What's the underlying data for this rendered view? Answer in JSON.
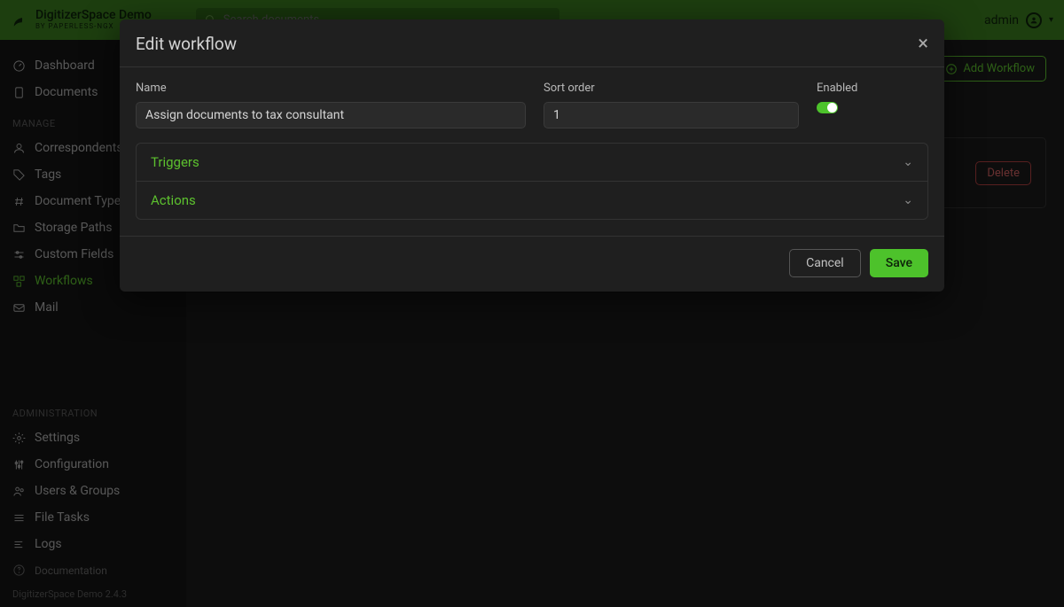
{
  "brand": {
    "title": "DigitizerSpace Demo",
    "subtitle": "BY PAPERLESS-NGX"
  },
  "search": {
    "placeholder": "Search documents"
  },
  "user": {
    "name": "admin"
  },
  "sidebar": {
    "main": [
      {
        "label": "Dashboard"
      },
      {
        "label": "Documents"
      }
    ],
    "manage_section": "MANAGE",
    "manage": [
      {
        "label": "Correspondents"
      },
      {
        "label": "Tags"
      },
      {
        "label": "Document Types"
      },
      {
        "label": "Storage Paths"
      },
      {
        "label": "Custom Fields"
      },
      {
        "label": "Workflows"
      },
      {
        "label": "Mail"
      }
    ],
    "admin_section": "ADMINISTRATION",
    "admin": [
      {
        "label": "Settings"
      },
      {
        "label": "Configuration"
      },
      {
        "label": "Users & Groups"
      },
      {
        "label": "File Tasks"
      },
      {
        "label": "Logs"
      }
    ],
    "doc_link": "Documentation",
    "footer": "DigitizerSpace Demo 2.4.3"
  },
  "toolbar": {
    "add_workflow": "Add Workflow",
    "delete": "Delete"
  },
  "modal": {
    "title": "Edit workflow",
    "name_label": "Name",
    "name_value": "Assign documents to tax consultant",
    "sort_label": "Sort order",
    "sort_value": "1",
    "enabled_label": "Enabled",
    "triggers": "Triggers",
    "actions": "Actions",
    "cancel": "Cancel",
    "save": "Save"
  }
}
